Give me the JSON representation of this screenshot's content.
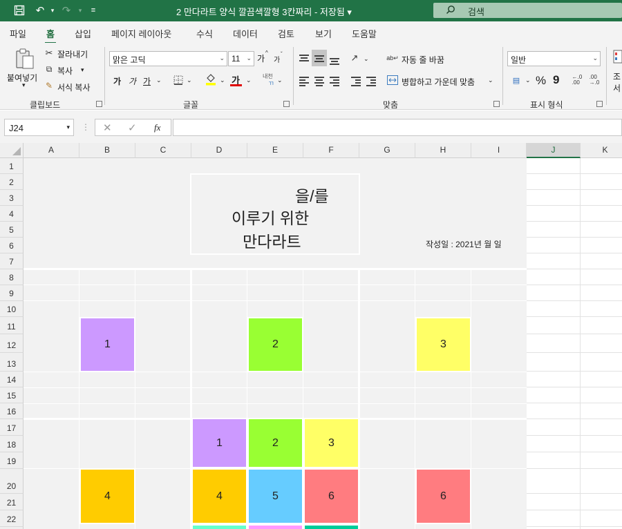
{
  "titlebar": {
    "doc_title": "2 만다라트 양식 깔끔색깔형 3칸짜리 - 저장됨 ▾",
    "search_label": "검색"
  },
  "tabs": [
    "파일",
    "홈",
    "삽입",
    "페이지 레이아웃",
    "수식",
    "데이터",
    "검토",
    "보기",
    "도움말"
  ],
  "ribbon": {
    "clipboard": {
      "paste": "붙여넣기",
      "cut": "잘라내기",
      "copy": "복사",
      "format_painter": "서식 복사",
      "group": "클립보드"
    },
    "font": {
      "name": "맑은 고딕",
      "size": "11",
      "bold": "가",
      "italic": "가",
      "underline": "가",
      "grow": "가",
      "shrink": "가",
      "font_color_glyph": "가",
      "phonetic": "내천",
      "group": "글꼴"
    },
    "align": {
      "wrap": "자동 줄 바꿈",
      "merge": "병합하고 가운데 맞춤",
      "group": "맞춤"
    },
    "number": {
      "format": "일반",
      "percent": "%",
      "comma": "9",
      "group": "표시 형식"
    },
    "partial": "조",
    "partial2": "서"
  },
  "formula_bar": {
    "name_box": "J24",
    "fx": "fx",
    "value": ""
  },
  "grid": {
    "columns": [
      "A",
      "B",
      "C",
      "D",
      "E",
      "F",
      "G",
      "H",
      "I",
      "J",
      "K"
    ],
    "selected_column": "J",
    "rows": [
      "1",
      "2",
      "3",
      "4",
      "5",
      "6",
      "7",
      "8",
      "9",
      "10",
      "11",
      "12",
      "13",
      "14",
      "15",
      "16",
      "17",
      "18",
      "19",
      "20",
      "21",
      "22"
    ]
  },
  "sheet": {
    "title_line1": "을/를",
    "title_line2": "이루기 위한",
    "title_line3": "만다라트",
    "date_line": "작성일 : 2021년    월    일",
    "boxes": [
      {
        "label": "1",
        "color": "#cc99ff"
      },
      {
        "label": "2",
        "color": "#99ff33"
      },
      {
        "label": "3",
        "color": "#ffff66"
      },
      {
        "label": "1",
        "color": "#cc99ff"
      },
      {
        "label": "2",
        "color": "#99ff33"
      },
      {
        "label": "3",
        "color": "#ffff66"
      },
      {
        "label": "4",
        "color": "#ffcc00"
      },
      {
        "label": "4",
        "color": "#ffcc00"
      },
      {
        "label": "5",
        "color": "#66ccff"
      },
      {
        "label": "6",
        "color": "#ff7c80"
      },
      {
        "label": "6",
        "color": "#ff7c80"
      },
      {
        "label": "",
        "color": "#66ffcc"
      },
      {
        "label": "",
        "color": "#ff99ff"
      },
      {
        "label": "",
        "color": "#00cc99"
      }
    ]
  },
  "colors": {
    "excel_green": "#217346",
    "sheet_bg": "#f2f2f2"
  }
}
